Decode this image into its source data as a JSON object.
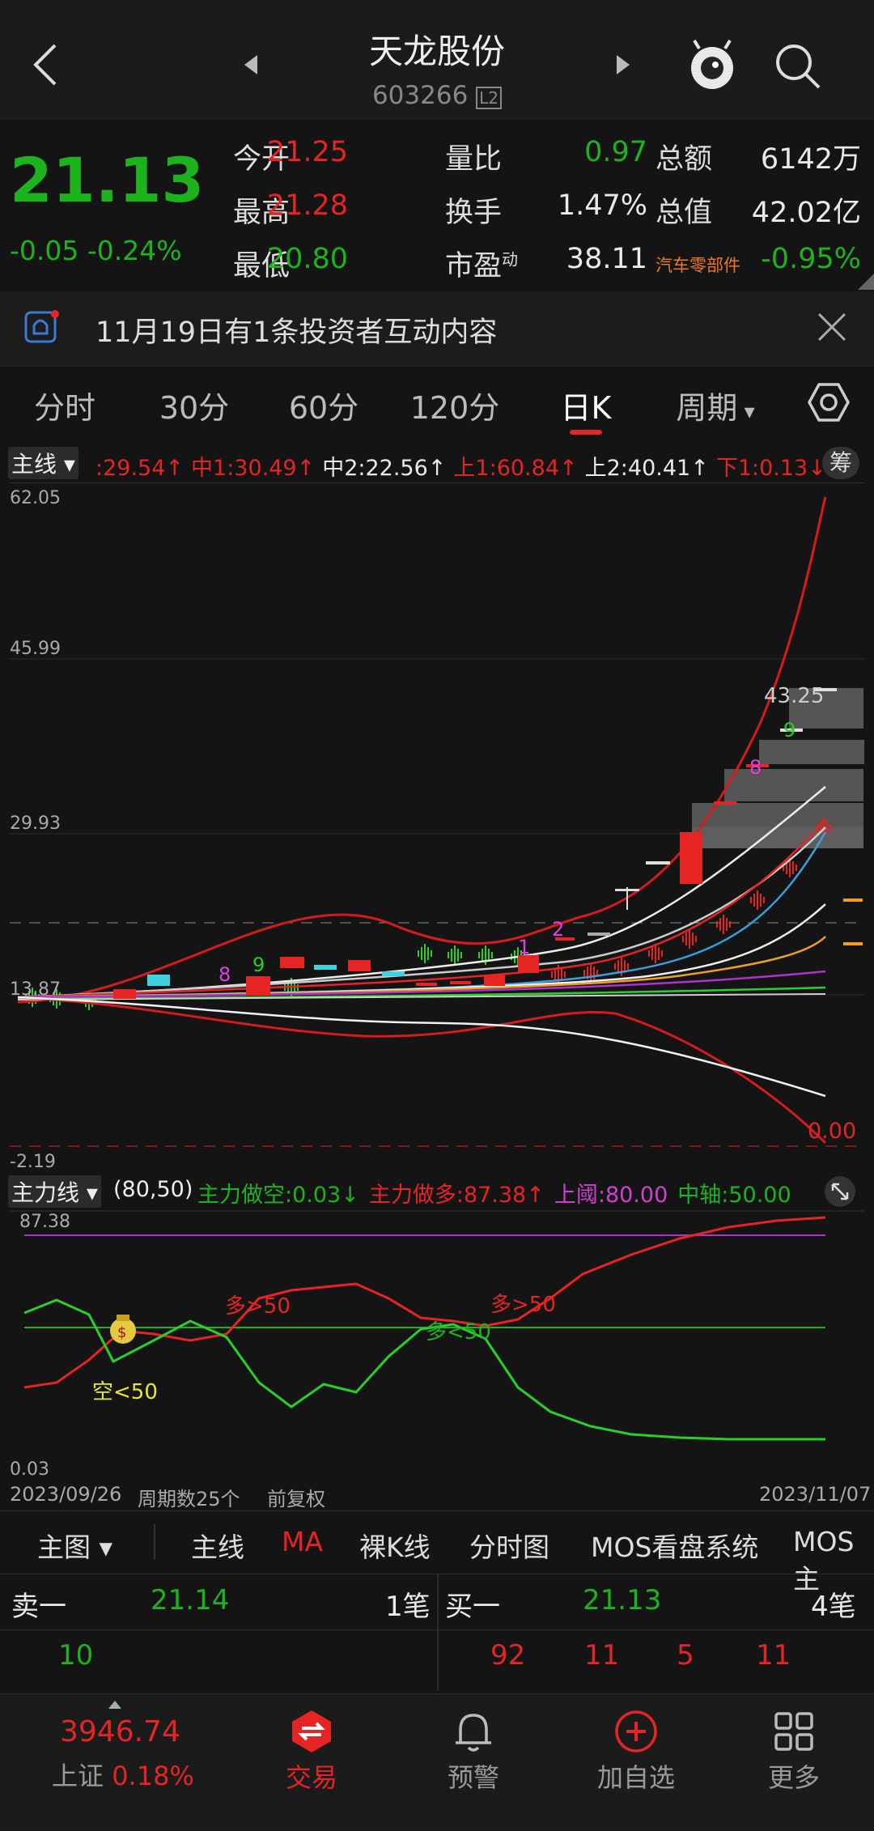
{
  "header": {
    "title": "天龙股份",
    "code": "603266",
    "code_badge": "L2"
  },
  "quote": {
    "price": "21.13",
    "change": "-0.05",
    "change_pct": "-0.24%",
    "rows": [
      [
        {
          "l": "今开",
          "v": "21.25",
          "c": "red"
        },
        {
          "l": "量比",
          "v": "0.97",
          "c": "green"
        },
        {
          "l": "总额",
          "v": "6142万",
          "c": "white"
        }
      ],
      [
        {
          "l": "最高",
          "v": "21.28",
          "c": "red"
        },
        {
          "l": "换手",
          "v": "1.47%",
          "c": "white"
        },
        {
          "l": "总值",
          "v": "42.02亿",
          "c": "white"
        }
      ],
      [
        {
          "l": "最低",
          "v": "20.80",
          "c": "green"
        },
        {
          "l": "市盈",
          "sup": "动",
          "v": "38.11",
          "c": "white"
        },
        {
          "l": "汽车零部件",
          "v": "-0.95%",
          "c": "green"
        }
      ]
    ]
  },
  "notice": {
    "text": "11月19日有1条投资者互动内容"
  },
  "tabs": [
    "分时",
    "30分",
    "60分",
    "120分",
    "日K",
    "周期"
  ],
  "active_tab": "日K",
  "main_indicator": {
    "label": "主线",
    "values": [
      {
        "t": ":29.54↑",
        "c": "#e62424"
      },
      {
        "t": "中1:30.49↑",
        "c": "#e62424"
      },
      {
        "t": "中2:22.56↑",
        "c": "#eaeaea"
      },
      {
        "t": "上1:60.84↑",
        "c": "#e62424"
      },
      {
        "t": "上2:40.41↑",
        "c": "#eaeaea"
      },
      {
        "t": "下1:0.13↓",
        "c": "#e62424"
      },
      {
        "t": "⅂",
        "c": "#eaeaea"
      }
    ],
    "chip_button": "筹"
  },
  "main_axis": {
    "labels": [
      "62.05",
      "45.99",
      "29.93",
      "13.87",
      "-2.19"
    ],
    "price_tag": "43.25",
    "zero_tag": "0.00"
  },
  "markers": [
    {
      "t": "8",
      "c": "#e040e0"
    },
    {
      "t": "9",
      "c": "#28d028"
    },
    {
      "t": "1",
      "c": "#e040e0"
    },
    {
      "t": "2",
      "c": "#e040e0"
    },
    {
      "t": "8",
      "c": "#e040e0"
    },
    {
      "t": "9",
      "c": "#28d028"
    }
  ],
  "sub_indicator": {
    "label": "主力线",
    "params": "(80,50)",
    "values": [
      {
        "t": "主力做空:0.03↓",
        "c": "#1db31d"
      },
      {
        "t": "主力做多:87.38↑",
        "c": "#e62424"
      },
      {
        "t": "上阈:80.00",
        "c": "#d040d0"
      },
      {
        "t": "中轴:50.00",
        "c": "#1db31d"
      }
    ]
  },
  "sub_axis": {
    "top": "87.38",
    "bottom": "0.03"
  },
  "sub_annotations": [
    {
      "t": "多>50",
      "c": "#e62424"
    },
    {
      "t": "多>50",
      "c": "#e62424"
    },
    {
      "t": "多<50",
      "c": "#1db31d"
    },
    {
      "t": "空<50",
      "c": "#e8e830"
    }
  ],
  "date_bar": {
    "start": "2023/09/26",
    "period": "周期数25个",
    "adjust": "前复权",
    "end": "2023/11/07"
  },
  "view_bar": {
    "dropdown": "主图",
    "items": [
      "主线",
      "MA",
      "裸K线",
      "分时图",
      "MOS看盘系统",
      "MOS主"
    ],
    "active": "MA"
  },
  "book": {
    "sell_label": "卖一",
    "sell_price": "21.14",
    "sell_count": "1笔",
    "sell_vol": [
      "10"
    ],
    "buy_label": "买一",
    "buy_price": "21.13",
    "buy_count": "4笔",
    "buy_vols": [
      "92",
      "11",
      "5",
      "11"
    ]
  },
  "bottom": {
    "index_value": "3946.74",
    "index_name": "上证",
    "index_pct": "0.18%",
    "items": [
      {
        "label": "交易",
        "icon": "trade-icon"
      },
      {
        "label": "预警",
        "icon": "bell-icon"
      },
      {
        "label": "加自选",
        "icon": "add-icon"
      },
      {
        "label": "更多",
        "icon": "grid-icon"
      }
    ]
  },
  "colors": {
    "up": "#e62424",
    "down": "#1db31d",
    "bg": "#141414"
  }
}
